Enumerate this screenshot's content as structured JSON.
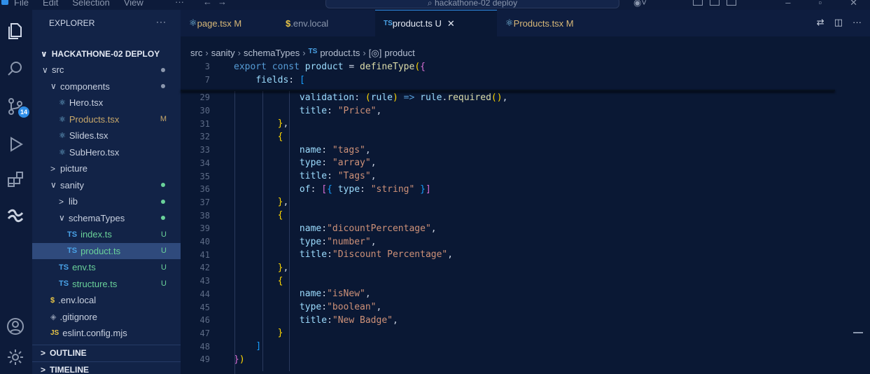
{
  "titlebar": {
    "menu": [
      "File",
      "Edit",
      "Selection",
      "View"
    ],
    "more": "···",
    "search_text": "hackathone-02 deploy"
  },
  "activity": {
    "scm_badge": "14"
  },
  "sidebar": {
    "title": "EXPLORER",
    "more": "···",
    "section": "HACKATHONE-02 DEPLOY",
    "tree": [
      {
        "label": "src",
        "chev": "∨",
        "indent": 0,
        "icon": "",
        "status": "",
        "dot": true
      },
      {
        "label": "components",
        "chev": "∨",
        "indent": 1,
        "icon": "",
        "status": "",
        "dot": true
      },
      {
        "label": "Hero.tsx",
        "chev": "",
        "indent": 2,
        "icon": "react",
        "status": "",
        "dot": false
      },
      {
        "label": "Products.tsx",
        "chev": "",
        "indent": 2,
        "icon": "react",
        "status": "M",
        "dot": false
      },
      {
        "label": "Slides.tsx",
        "chev": "",
        "indent": 2,
        "icon": "react",
        "status": "",
        "dot": false
      },
      {
        "label": "SubHero.tsx",
        "chev": "",
        "indent": 2,
        "icon": "react",
        "status": "",
        "dot": false
      },
      {
        "label": "picture",
        "chev": ">",
        "indent": 1,
        "icon": "",
        "status": "",
        "dot": false
      },
      {
        "label": "sanity",
        "chev": "∨",
        "indent": 1,
        "icon": "",
        "status": "",
        "dot": true
      },
      {
        "label": "lib",
        "chev": ">",
        "indent": 2,
        "icon": "",
        "status": "",
        "dot": true
      },
      {
        "label": "schemaTypes",
        "chev": "∨",
        "indent": 2,
        "icon": "",
        "status": "",
        "dot": true
      },
      {
        "label": "index.ts",
        "chev": "",
        "indent": 3,
        "icon": "ts",
        "status": "U",
        "dot": false
      },
      {
        "label": "product.ts",
        "chev": "",
        "indent": 3,
        "icon": "ts",
        "status": "U",
        "dot": false
      },
      {
        "label": "env.ts",
        "chev": "",
        "indent": 2,
        "icon": "ts",
        "status": "U",
        "dot": false
      },
      {
        "label": "structure.ts",
        "chev": "",
        "indent": 2,
        "icon": "ts",
        "status": "U",
        "dot": false
      },
      {
        "label": ".env.local",
        "chev": "",
        "indent": 1,
        "icon": "env",
        "status": "",
        "dot": false
      },
      {
        "label": ".gitignore",
        "chev": "",
        "indent": 1,
        "icon": "git",
        "status": "",
        "dot": false
      },
      {
        "label": "eslint.config.mjs",
        "chev": "",
        "indent": 1,
        "icon": "js",
        "status": "",
        "dot": false
      }
    ],
    "outline": "OUTLINE",
    "timeline": "TIMELINE"
  },
  "editor": {
    "tabs": [
      {
        "label": "page.tsx M",
        "icon": "react"
      },
      {
        "label": ".env.local",
        "icon": "env"
      },
      {
        "label": "product.ts U",
        "icon": "ts"
      },
      {
        "label": "Products.tsx M",
        "icon": "react"
      }
    ],
    "active_tab": 2,
    "close_glyph": "✕",
    "breadcrumb": [
      "src",
      "sanity",
      "schemaTypes",
      "product.ts",
      "product"
    ],
    "sticky_lines": [
      {
        "n": "3",
        "html": "<span class='kw'>export</span> <span class='kw'>const</span> <span class='var'>product</span> = <span class='fn'>defineType</span><span class='b1'>(</span><span class='b2'>{</span>"
      },
      {
        "n": "7",
        "html": "    <span class='var'>fields</span>: <span class='b3'>[</span>"
      }
    ],
    "lines": [
      {
        "n": "29",
        "html": "            <span class='var'>validation</span>: <span class='b1'>(</span><span class='var'>rule</span><span class='b1'>)</span> <span class='kw'>=></span> <span class='var'>rule</span>.<span class='fn'>required</span><span class='b1'>()</span>,"
      },
      {
        "n": "30",
        "html": "            <span class='var'>title</span>: <span class='str'>\"Price\"</span>,"
      },
      {
        "n": "31",
        "html": "        <span class='b1'>}</span>,"
      },
      {
        "n": "32",
        "html": "        <span class='b1'>{</span>"
      },
      {
        "n": "33",
        "html": "            <span class='var'>name</span>: <span class='str'>\"tags\"</span>,"
      },
      {
        "n": "34",
        "html": "            <span class='var'>type</span>: <span class='str'>\"array\"</span>,"
      },
      {
        "n": "35",
        "html": "            <span class='var'>title</span>: <span class='str'>\"Tags\"</span>,"
      },
      {
        "n": "36",
        "html": "            <span class='var'>of</span>: <span class='b2'>[</span><span class='b3'>{</span> <span class='var'>type</span>: <span class='str'>\"string\"</span> <span class='b3'>}</span><span class='b2'>]</span>"
      },
      {
        "n": "37",
        "html": "        <span class='b1'>}</span>,"
      },
      {
        "n": "38",
        "html": "        <span class='b1'>{</span>"
      },
      {
        "n": "39",
        "html": "            <span class='var'>name</span>:<span class='str'>\"dicountPercentage\"</span>,"
      },
      {
        "n": "40",
        "html": "            <span class='var'>type</span>:<span class='str'>\"number\"</span>,"
      },
      {
        "n": "41",
        "html": "            <span class='var'>title</span>:<span class='str'>\"Discount Percentage\"</span>,"
      },
      {
        "n": "42",
        "html": "        <span class='b1'>}</span>,"
      },
      {
        "n": "43",
        "html": "        <span class='b1'>{</span>"
      },
      {
        "n": "44",
        "html": "            <span class='var'>name</span>:<span class='str'>\"isNew\"</span>,"
      },
      {
        "n": "45",
        "html": "            <span class='var'>type</span>:<span class='str'>\"boolean\"</span>,"
      },
      {
        "n": "46",
        "html": "            <span class='var'>title</span>:<span class='str'>\"New Badge\"</span>,"
      },
      {
        "n": "47",
        "html": "        <span class='b1'>}</span>"
      },
      {
        "n": "48",
        "html": "    <span class='b3'>]</span>"
      },
      {
        "n": "49",
        "html": "<span class='b2'>}</span><span class='b1'>)</span>"
      }
    ]
  }
}
